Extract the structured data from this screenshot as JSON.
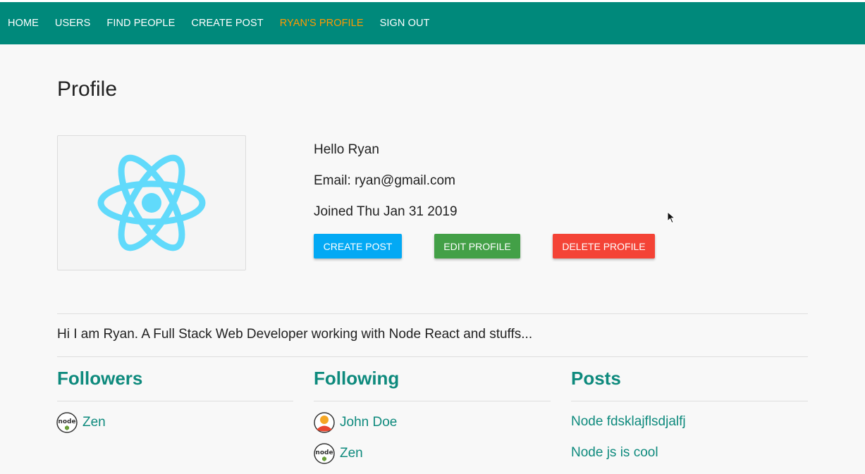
{
  "colors": {
    "nav_bg": "#00897b",
    "nav_text": "#ffffff",
    "nav_active": "#ff9900",
    "accent_teal": "#0e8a7d",
    "btn_create": "#03a9f4",
    "btn_edit": "#43a047",
    "btn_delete": "#f44336",
    "react_logo": "#61dafb"
  },
  "nav": {
    "items": [
      {
        "label": "HOME",
        "active": false
      },
      {
        "label": "USERS",
        "active": false
      },
      {
        "label": "FIND PEOPLE",
        "active": false
      },
      {
        "label": "CREATE POST",
        "active": false
      },
      {
        "label": "RYAN'S PROFILE",
        "active": true
      },
      {
        "label": "SIGN OUT",
        "active": false
      }
    ]
  },
  "profile": {
    "title": "Profile",
    "avatar_icon": "react-logo-icon",
    "greeting": "Hello Ryan",
    "email": "Email: ryan@gmail.com",
    "joined": "Joined Thu Jan 31 2019",
    "about": "Hi I am Ryan. A Full Stack Web Developer working with Node React and stuffs..."
  },
  "actions": {
    "create_post": "CREATE POST",
    "edit_profile": "EDIT PROFILE",
    "delete_profile": "DELETE PROFILE"
  },
  "followers": {
    "title": "Followers",
    "items": [
      {
        "name": "Zen",
        "avatar": "nodejs-avatar-icon"
      }
    ]
  },
  "following": {
    "title": "Following",
    "items": [
      {
        "name": "John Doe",
        "avatar": "default-user-avatar-icon"
      },
      {
        "name": "Zen",
        "avatar": "nodejs-avatar-icon"
      }
    ]
  },
  "posts": {
    "title": "Posts",
    "items": [
      {
        "title": "Node fdsklajflsdjalfj"
      },
      {
        "title": "Node js is cool"
      }
    ]
  }
}
